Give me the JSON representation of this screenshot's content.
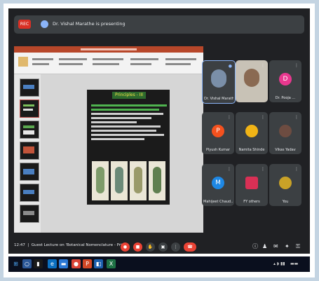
{
  "meeting": {
    "rec_label": "REC",
    "presenting_text": "Dr. Vishal Marathe is presenting",
    "clock": "12:47",
    "meeting_title": "Guest Lecture on 'Botanical Nomenclature - Pri...'"
  },
  "slide": {
    "title": "Principles - III"
  },
  "participants": [
    {
      "name": "Dr. Vishal Marathe",
      "type": "video"
    },
    {
      "name": "",
      "type": "video"
    },
    {
      "name": "Dr. Pooja ...",
      "type": "initial",
      "initial": "D",
      "color": "#e8388f"
    },
    {
      "name": "Piyush Kumar",
      "type": "initial",
      "initial": "P",
      "color": "#f4511e"
    },
    {
      "name": "Namita Shinde",
      "type": "photo"
    },
    {
      "name": "Vikas Yadav",
      "type": "photo"
    },
    {
      "name": "Mahijeet Chaud...",
      "type": "initial",
      "initial": "M",
      "color": "#1e88e5"
    },
    {
      "name": "FY others",
      "type": "photo"
    },
    {
      "name": "You",
      "type": "photo"
    }
  ],
  "colors": {
    "meet_bg": "#202124",
    "tile_bg": "#3c4043",
    "end_call": "#ea4335",
    "ppt_accent": "#b7472a"
  },
  "icons": [
    "mic-off-icon",
    "camera-off-icon",
    "raise-hand-icon",
    "present-icon",
    "more-icon",
    "end-call-icon",
    "info-icon",
    "people-icon",
    "chat-icon",
    "activities-icon"
  ]
}
